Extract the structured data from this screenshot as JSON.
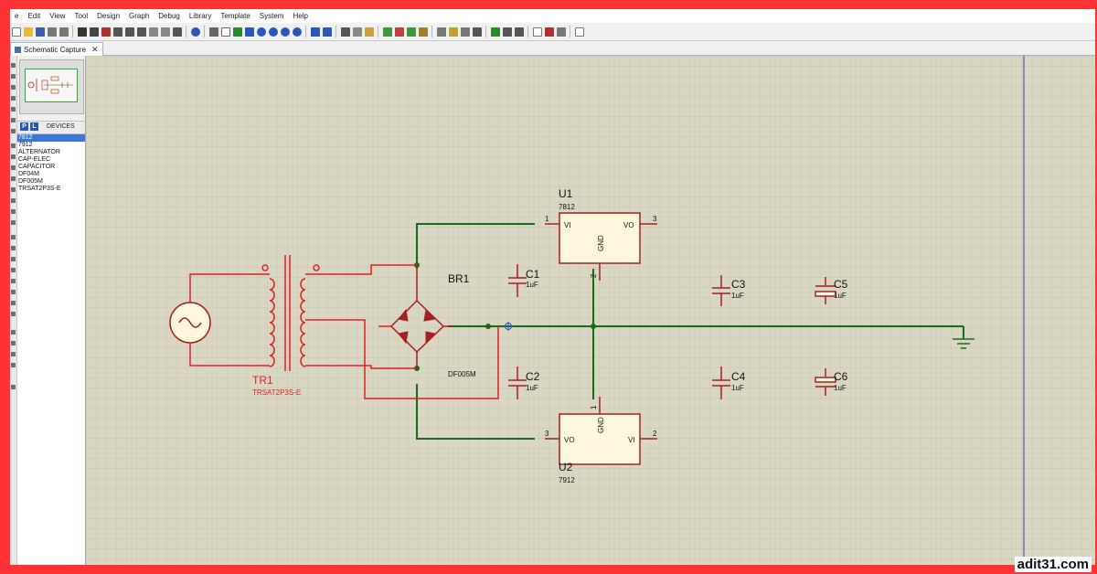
{
  "menu": [
    "e",
    "Edit",
    "View",
    "Tool",
    "Design",
    "Graph",
    "Debug",
    "Library",
    "Template",
    "System",
    "Help"
  ],
  "tab": {
    "label": "Schematic Capture",
    "close": "✕"
  },
  "devices": {
    "pick_label": "P",
    "lib_label": "L",
    "header": "DEVICES",
    "items": [
      "7812",
      "7912",
      "ALTERNATOR",
      "CAP-ELEC",
      "CAPACITOR",
      "DF04M",
      "DF005M",
      "TRSAT2P3S-E"
    ],
    "selected_index": 0
  },
  "schematic": {
    "u1": {
      "ref": "U1",
      "value": "7812",
      "pin_in": "VI",
      "pin_out": "VO",
      "pin_gnd": "GND",
      "num_in": "1",
      "num_out": "3",
      "num_gnd": "2"
    },
    "u2": {
      "ref": "U2",
      "value": "7912",
      "pin_in": "VI",
      "pin_out": "VO",
      "pin_gnd": "GND",
      "num_in": "2",
      "num_out": "3",
      "num_gnd": "1"
    },
    "br1": {
      "ref": "BR1",
      "value": "DF005M"
    },
    "tr1": {
      "ref": "TR1",
      "value": "TRSAT2P3S-E"
    },
    "caps": [
      {
        "ref": "C1",
        "value": "1uF"
      },
      {
        "ref": "C2",
        "value": "1uF"
      },
      {
        "ref": "C3",
        "value": "1uF"
      },
      {
        "ref": "C4",
        "value": "1uF"
      },
      {
        "ref": "C5",
        "value": "1uF"
      },
      {
        "ref": "C6",
        "value": "1uF"
      }
    ]
  },
  "colors": {
    "wire": "#1a6b1a",
    "component": "#a52020",
    "grid_bg": "#d8d5c0",
    "grid_line": "#c4c2ad",
    "part_fill": "#fff8dc",
    "selection": "#e02020",
    "frame": "#ff3333"
  },
  "icons": [
    "new-icon",
    "open-icon",
    "save-icon",
    "print-icon",
    "help-icon",
    "grid-icon",
    "zoom-in-icon",
    "zoom-out-icon",
    "undo-icon",
    "redo-icon",
    "cut-icon",
    "copy-icon",
    "paste-icon",
    "ground-icon",
    "ac-source-icon"
  ],
  "watermark": "adit31.com"
}
